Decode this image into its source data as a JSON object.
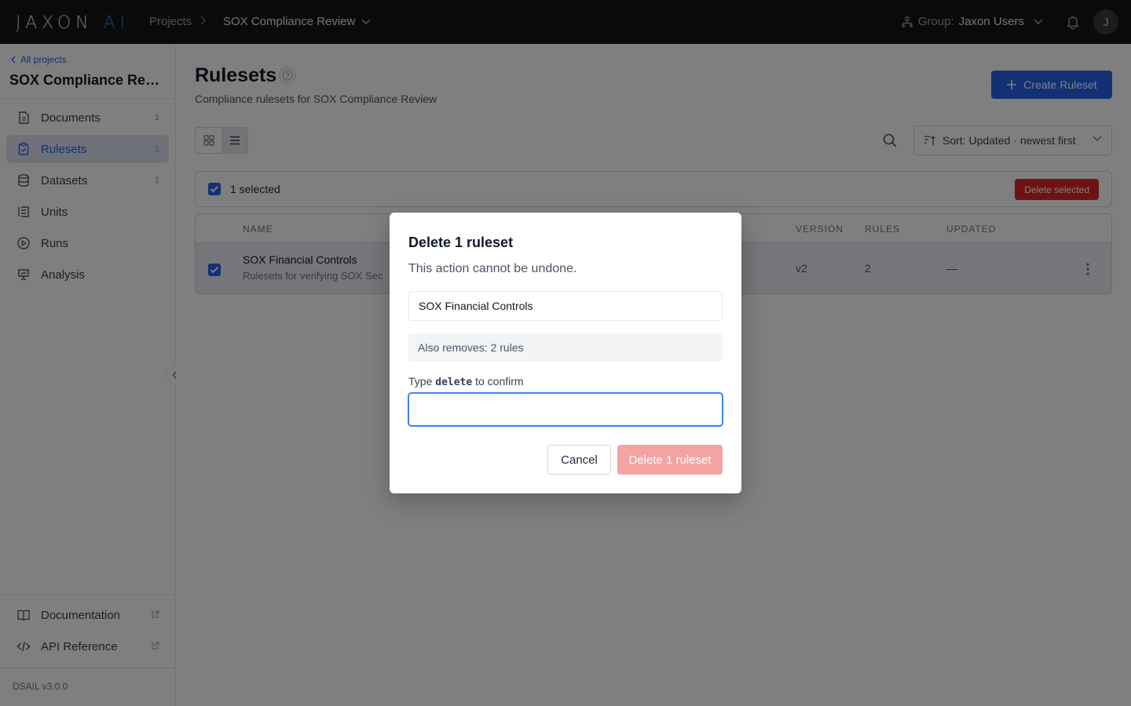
{
  "topbar": {
    "logo_main": "JAXON",
    "logo_dot": ".",
    "logo_ai": "AI",
    "crumb_projects": "Projects",
    "crumb_current": "SOX Compliance Review",
    "group_label": "Group:",
    "group_value": "Jaxon Users",
    "avatar_initial": "J"
  },
  "sidebar": {
    "back_link": "All projects",
    "project_title": "SOX Compliance Review",
    "items": [
      {
        "label": "Documents",
        "count": "1",
        "icon": "document-icon"
      },
      {
        "label": "Rulesets",
        "count": "1",
        "icon": "clipboard-check-icon",
        "active": true
      },
      {
        "label": "Datasets",
        "count": "1",
        "icon": "database-icon"
      },
      {
        "label": "Units",
        "count": "",
        "icon": "units-icon"
      },
      {
        "label": "Runs",
        "count": "",
        "icon": "play-circle-icon"
      },
      {
        "label": "Analysis",
        "count": "",
        "icon": "presentation-chart-icon"
      }
    ],
    "footer_items": [
      {
        "label": "Documentation",
        "icon": "book-icon"
      },
      {
        "label": "API Reference",
        "icon": "code-icon"
      }
    ],
    "version": "DSAIL v3.0.0"
  },
  "main": {
    "title": "Rulesets",
    "subtitle": "Compliance rulesets for SOX Compliance Review",
    "create_button": "Create Ruleset",
    "sort_label": "Sort: Updated · newest first",
    "selection": {
      "count_text": "1 selected",
      "delete_button": "Delete selected"
    },
    "table": {
      "columns": [
        "NAME",
        "VERSION",
        "RULES",
        "UPDATED"
      ],
      "rows": [
        {
          "name": "SOX Financial Controls",
          "description": "Rulesets for verifying SOX Sec",
          "version": "v2",
          "rules": "2",
          "updated": "—"
        }
      ]
    }
  },
  "modal": {
    "title": "Delete 1 ruleset",
    "subtitle": "This action cannot be undone.",
    "item_name": "SOX Financial Controls",
    "also_removes": "Also removes: 2 rules",
    "confirm_prefix": "Type",
    "confirm_keyword": "delete",
    "confirm_suffix": "to confirm",
    "input_value": "",
    "cancel_button": "Cancel",
    "confirm_button": "Delete 1 ruleset"
  },
  "colors": {
    "accent": "#2563eb",
    "danger": "#dc2626",
    "danger_disabled": "#f4a3a3",
    "topbar": "#141416"
  }
}
